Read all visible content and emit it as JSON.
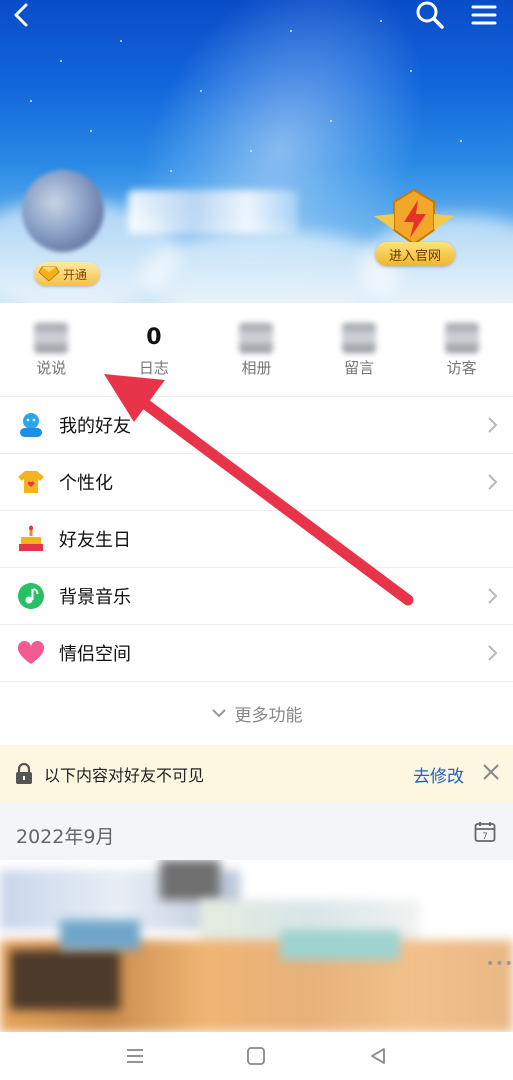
{
  "header": {
    "vip_label": "开通",
    "official_label": "进入官网"
  },
  "stats": [
    {
      "label": "说说",
      "value": ""
    },
    {
      "label": "日志",
      "value": "0"
    },
    {
      "label": "相册",
      "value": ""
    },
    {
      "label": "留言",
      "value": ""
    },
    {
      "label": "访客",
      "value": ""
    }
  ],
  "menu": {
    "items": [
      {
        "label": "我的好友",
        "icon": "friends-icon"
      },
      {
        "label": "个性化",
        "icon": "tshirt-icon"
      },
      {
        "label": "好友生日",
        "icon": "cake-icon"
      },
      {
        "label": "背景音乐",
        "icon": "music-icon"
      },
      {
        "label": "情侣空间",
        "icon": "heart-icon"
      }
    ],
    "more_label": "更多功能"
  },
  "privacy": {
    "text": "以下内容对好友不可见",
    "edit_label": "去修改"
  },
  "feed": {
    "month": "2022年9月",
    "more_dots": "•••"
  },
  "colors": {
    "accent": "#1b63c4",
    "arrow": "#e8344a",
    "privacy_bg": "#fdf7e1"
  }
}
